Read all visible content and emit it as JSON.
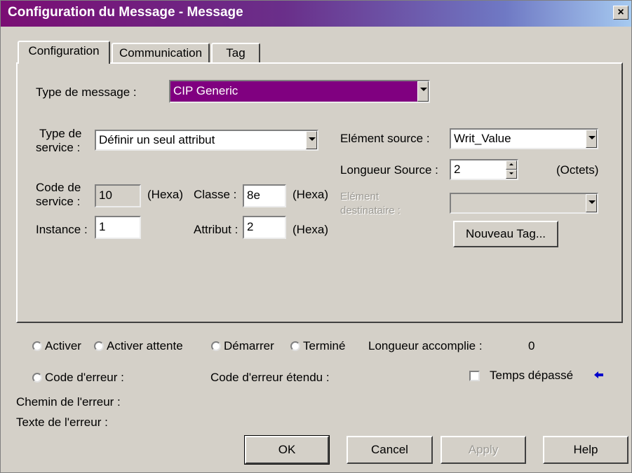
{
  "window": {
    "title": "Configuration du Message - Message",
    "close_label": "×"
  },
  "tabs": [
    {
      "label": "Configuration"
    },
    {
      "label": "Communication"
    },
    {
      "label": "Tag"
    }
  ],
  "config": {
    "message_type": {
      "label": "Type de message :",
      "value": "CIP Generic"
    },
    "service_type": {
      "label_line1": "Type de",
      "label_line2": "service :",
      "value": "Définir un seul attribut"
    },
    "service_code": {
      "label_line1": "Code de",
      "label_line2": "service :",
      "value": "10",
      "unit": "(Hexa)"
    },
    "class": {
      "label": "Classe :",
      "value": "8e",
      "unit": "(Hexa)"
    },
    "instance": {
      "label": "Instance :",
      "value": "1"
    },
    "attribute": {
      "label": "Attribut :",
      "value": "2",
      "unit": "(Hexa)"
    },
    "source_element": {
      "label": "Elément source :",
      "value": "Writ_Value"
    },
    "source_length": {
      "label": "Longueur Source :",
      "value": "2",
      "unit": "(Octets)"
    },
    "destination_element": {
      "label_line1": "Elément",
      "label_line2": "destinataire :",
      "value": ""
    },
    "new_tag_button": "Nouveau Tag..."
  },
  "status": {
    "activate": "Activer",
    "activate_wait": "Activer attente",
    "start": "Démarrer",
    "done": "Terminé",
    "length_done_label": "Longueur accomplie :",
    "length_done_value": "0",
    "error_code": "Code d'erreur :",
    "extended_error_code": "Code d'erreur étendu :",
    "timeout_label": "Temps dépassé",
    "error_path": "Chemin de l'erreur :",
    "error_text": "Texte de l'erreur :"
  },
  "buttons": {
    "ok": "OK",
    "cancel": "Cancel",
    "apply": "Apply",
    "help": "Help"
  },
  "colors": {
    "dialog_bg": "#d4d0c8",
    "title_start": "#7a0e74",
    "selected_field": "#800080",
    "arrow_icon": "#0000cc"
  },
  "icons": {
    "close": "close-icon",
    "dropdown": "chevron-down-icon",
    "timeout_indicator": "arrow-left-icon"
  }
}
